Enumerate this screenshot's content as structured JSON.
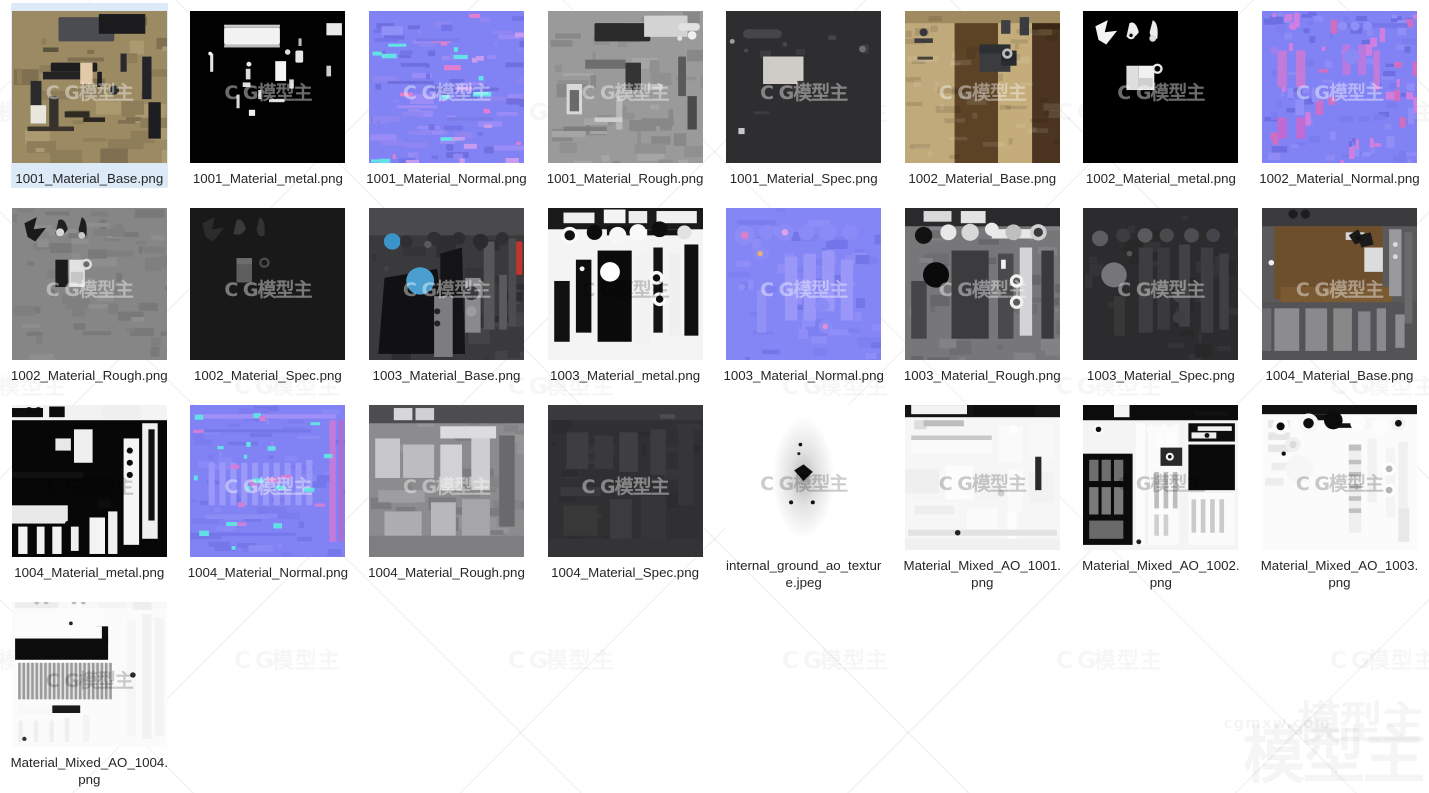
{
  "window": {
    "view_mode": "thumbnail-grid",
    "columns": 8,
    "selected_index": 0,
    "selection_color": "#dbeaf6",
    "background_color": "#ffffff",
    "label_color": "#262626"
  },
  "watermark": {
    "logo_text": "C G",
    "cn_text": "模型主",
    "domain_text": "cgmxw.com",
    "color": "rgba(0,0,0,0.04)"
  },
  "files": [
    {
      "name": "1001_Material_Base.png",
      "kind": "base",
      "selected": true,
      "wm": "light"
    },
    {
      "name": "1001_Material_metal.png",
      "kind": "metal",
      "selected": false,
      "wm": "light"
    },
    {
      "name": "1001_Material_Normal.png",
      "kind": "normal",
      "selected": false,
      "wm": "light"
    },
    {
      "name": "1001_Material_Rough.png",
      "kind": "rough",
      "selected": false,
      "wm": "light"
    },
    {
      "name": "1001_Material_Spec.png",
      "kind": "spec",
      "selected": false,
      "wm": "light"
    },
    {
      "name": "1002_Material_Base.png",
      "kind": "base2",
      "selected": false,
      "wm": "light"
    },
    {
      "name": "1002_Material_metal.png",
      "kind": "metal2",
      "selected": false,
      "wm": "light"
    },
    {
      "name": "1002_Material_Normal.png",
      "kind": "normal2",
      "selected": false,
      "wm": "light"
    },
    {
      "name": "1002_Material_Rough.png",
      "kind": "rough2",
      "selected": false,
      "wm": "light"
    },
    {
      "name": "1002_Material_Spec.png",
      "kind": "spec2",
      "selected": false,
      "wm": "light"
    },
    {
      "name": "1003_Material_Base.png",
      "kind": "base3",
      "selected": false,
      "wm": "light"
    },
    {
      "name": "1003_Material_metal.png",
      "kind": "metal3",
      "selected": false,
      "wm": "dark"
    },
    {
      "name": "1003_Material_Normal.png",
      "kind": "normal3",
      "selected": false,
      "wm": "light"
    },
    {
      "name": "1003_Material_Rough.png",
      "kind": "rough3",
      "selected": false,
      "wm": "light"
    },
    {
      "name": "1003_Material_Spec.png",
      "kind": "spec3",
      "selected": false,
      "wm": "light"
    },
    {
      "name": "1004_Material_Base.png",
      "kind": "base4",
      "selected": false,
      "wm": "light"
    },
    {
      "name": "1004_Material_metal.png",
      "kind": "metal4",
      "selected": false,
      "wm": "dark"
    },
    {
      "name": "1004_Material_Normal.png",
      "kind": "normal4",
      "selected": false,
      "wm": "light"
    },
    {
      "name": "1004_Material_Rough.png",
      "kind": "rough4",
      "selected": false,
      "wm": "light"
    },
    {
      "name": "1004_Material_Spec.png",
      "kind": "spec4",
      "selected": false,
      "wm": "light"
    },
    {
      "name": "internal_ground_ao_texture.jpeg",
      "kind": "ao_ground",
      "selected": false,
      "wm": "dark"
    },
    {
      "name": "Material_Mixed_AO_1001.png",
      "kind": "ao1",
      "selected": false,
      "wm": "dark"
    },
    {
      "name": "Material_Mixed_AO_1002.png",
      "kind": "ao2",
      "selected": false,
      "wm": "dark"
    },
    {
      "name": "Material_Mixed_AO_1003.png",
      "kind": "ao3",
      "selected": false,
      "wm": "dark"
    },
    {
      "name": "Material_Mixed_AO_1004.png",
      "kind": "ao4",
      "selected": false,
      "wm": "dark"
    }
  ]
}
